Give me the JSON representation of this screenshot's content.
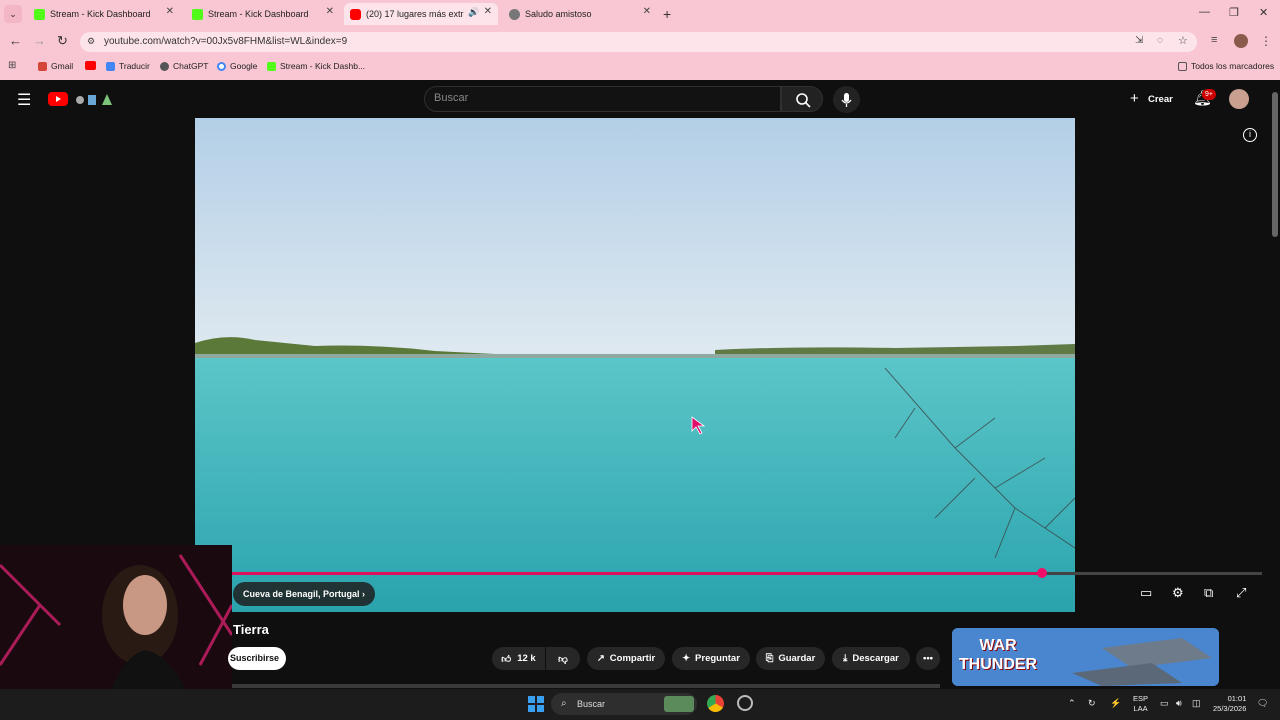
{
  "browser": {
    "tabs": [
      {
        "title": "Stream - Kick Dashboard",
        "favicon_color": "#53fc18"
      },
      {
        "title": "Stream - Kick Dashboard",
        "favicon_color": "#53fc18"
      },
      {
        "title": "(20) 17 lugares más extraño",
        "favicon_color": "#ff0000",
        "active": true
      },
      {
        "title": "Saludo amistoso",
        "favicon_color": "#666666"
      }
    ],
    "url": "youtube.com/watch?v=00Jx5v8FHM&list=WL&index=9",
    "bookmarks": [
      {
        "label": "Gmail",
        "icon": "gmail-icon"
      },
      {
        "label": "",
        "icon": "youtube-icon"
      },
      {
        "label": "Traducir",
        "icon": "translate-icon"
      },
      {
        "label": "ChatGPT",
        "icon": "chatgpt-icon"
      },
      {
        "label": "Google",
        "icon": "google-icon"
      },
      {
        "label": "Stream - Kick Dashb...",
        "icon": "kick-icon"
      }
    ],
    "all_bookmarks": "Todos los marcadores"
  },
  "youtube": {
    "search_placeholder": "Buscar",
    "create_label": "Crear",
    "notifications_badge": "9+",
    "chapter_label": "Cueva de Benagil, Portugal",
    "video_title": "Tierra",
    "subscribe_label": "Suscribirse",
    "actions": {
      "likes": "12 k",
      "share": "Compartir",
      "ask": "Preguntar",
      "save": "Guardar",
      "download": "Descargar"
    },
    "progress_fraction": 0.786,
    "ad_text": "WAR THUNDER"
  },
  "taskbar": {
    "search_label": "Buscar",
    "language": "ESP",
    "region": "LAA",
    "time": "01:01",
    "date": "25/3/2026"
  },
  "colors": {
    "browser_chrome": "#f9c7d3",
    "yt_background": "#0f0f0f",
    "progress": "#e0105a"
  }
}
